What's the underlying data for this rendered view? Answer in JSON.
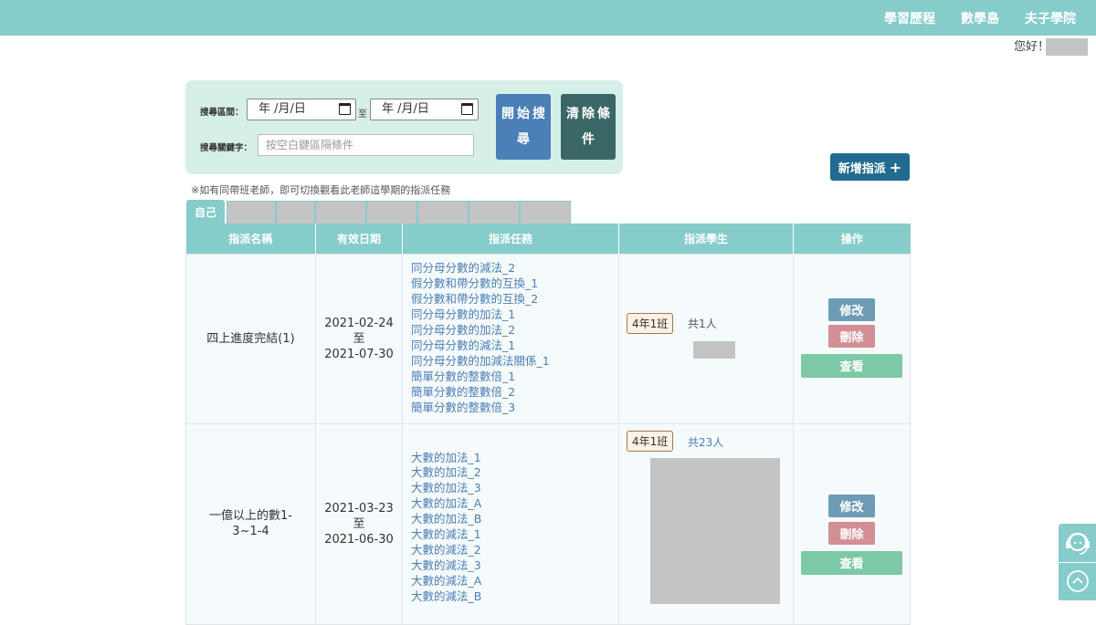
{
  "nav": {
    "items": [
      "學習歷程",
      "數學島",
      "夫子學院"
    ],
    "greeting": "您好！"
  },
  "search": {
    "range_label": "搜尋區間：",
    "start_date": "年 /月/日",
    "to": "至",
    "end_date": "年 /月/日",
    "keyword_label": "搜尋關鍵字：",
    "keyword_placeholder": "按空白鍵區隔條件",
    "search_button": "開始搜尋",
    "clear_button": "清除條件"
  },
  "add_button": "新增指派",
  "note": "※如有同帶班老師，即可切換觀看此老師這學期的指派任務",
  "tabs": {
    "self": "自己"
  },
  "table": {
    "headers": [
      "指派名稱",
      "有效日期",
      "指派任務",
      "指派學生",
      "操作"
    ],
    "rows": [
      {
        "name": "四上進度完結(1)",
        "start": "2021-02-24",
        "to": "至",
        "end": "2021-07-30",
        "tasks": [
          "同分母分數的減法_2",
          "假分數和帶分數的互換_1",
          "假分數和帶分數的互換_2",
          "同分母分數的加法_1",
          "同分母分數的加法_2",
          "同分母分數的減法_1",
          "同分母分數的加減法關係_1",
          "簡單分數的整數倍_1",
          "簡單分數的整數倍_2",
          "簡單分數的整數倍_3"
        ],
        "class": "4年1班",
        "count": "共1人",
        "edit": "修改",
        "delete": "刪除",
        "view": "查看"
      },
      {
        "name": "一億以上的數1-3~1-4",
        "start": "2021-03-23",
        "to": "至",
        "end": "2021-06-30",
        "tasks": [
          "大數的加法_1",
          "大數的加法_2",
          "大數的加法_3",
          "大數的加法_A",
          "大數的加法_B",
          "大數的減法_1",
          "大數的減法_2",
          "大數的減法_3",
          "大數的減法_A",
          "大數的減法_B"
        ],
        "class": "4年1班",
        "count": "共23人",
        "edit": "修改",
        "delete": "刪除",
        "view": "查看"
      }
    ]
  },
  "side": {
    "support_icon": "headset-support-icon",
    "top_icon": "chevron-up-circle-icon"
  },
  "colors": {
    "teal": "#85cccb",
    "panel": "#d6efe9",
    "search_btn": "#4a7fb7",
    "clear_btn": "#3b6666",
    "add_btn": "#216b8e",
    "link": "#4c7fb4",
    "edit": "#6e9bb5",
    "delete": "#d28f95",
    "view": "#7dc9a6"
  }
}
